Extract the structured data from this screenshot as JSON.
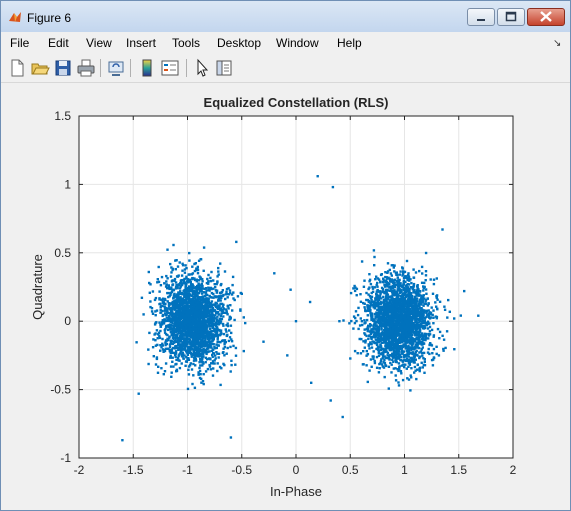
{
  "window": {
    "title": "Figure 6"
  },
  "menu": [
    "File",
    "Edit",
    "View",
    "Insert",
    "Tools",
    "Desktop",
    "Window",
    "Help"
  ],
  "toolbar": {
    "icons": [
      "new-file-icon",
      "open-file-icon",
      "save-icon",
      "print-icon",
      "link-icon",
      "colorbar-icon",
      "legend-icon",
      "pointer-icon",
      "property-editor-icon"
    ]
  },
  "colors": {
    "marker": "#0072bd",
    "titlebar": "#c3d6ee",
    "close": "#c5432d"
  },
  "chart_data": {
    "type": "scatter",
    "title": "Equalized Constellation (RLS)",
    "xlabel": "In-Phase",
    "ylabel": "Quadrature",
    "xlim": [
      -2,
      2
    ],
    "ylim": [
      -1,
      1.5
    ],
    "xticks": [
      -2,
      -1.5,
      -1,
      -0.5,
      0,
      0.5,
      1,
      1.5,
      2
    ],
    "yticks": [
      -1,
      -0.5,
      0,
      0.5,
      1,
      1.5
    ],
    "xtick_labels": [
      "-2",
      "-1.5",
      "-1",
      "-0.5",
      "0",
      "0.5",
      "1",
      "1.5",
      "2"
    ],
    "ytick_labels": [
      "-1",
      "-0.5",
      "0",
      "0.5",
      "1",
      "1.5"
    ],
    "grid": true,
    "clusters": [
      {
        "center": [
          -0.95,
          0.0
        ],
        "spread": [
          0.15,
          0.16
        ],
        "approx_count": 2500
      },
      {
        "center": [
          0.95,
          0.0
        ],
        "spread": [
          0.15,
          0.16
        ],
        "approx_count": 2500
      }
    ],
    "outliers": [
      {
        "x": 0.2,
        "y": 1.06
      },
      {
        "x": 0.34,
        "y": 0.98
      },
      {
        "x": 0.0,
        "y": 0.0
      },
      {
        "x": -0.2,
        "y": 0.35
      },
      {
        "x": -0.05,
        "y": 0.23
      },
      {
        "x": 0.13,
        "y": 0.14
      },
      {
        "x": 0.4,
        "y": 0.0
      },
      {
        "x": 0.14,
        "y": -0.45
      },
      {
        "x": 0.32,
        "y": -0.58
      },
      {
        "x": 0.43,
        "y": -0.7
      },
      {
        "x": -0.08,
        "y": -0.25
      },
      {
        "x": -1.6,
        "y": -0.87
      },
      {
        "x": -1.45,
        "y": -0.53
      },
      {
        "x": -0.6,
        "y": -0.85
      },
      {
        "x": -0.5,
        "y": 0.2
      },
      {
        "x": -0.3,
        "y": -0.15
      },
      {
        "x": 1.35,
        "y": 0.67
      },
      {
        "x": 1.68,
        "y": 0.04
      },
      {
        "x": 1.55,
        "y": 0.22
      },
      {
        "x": -0.55,
        "y": 0.58
      }
    ]
  }
}
